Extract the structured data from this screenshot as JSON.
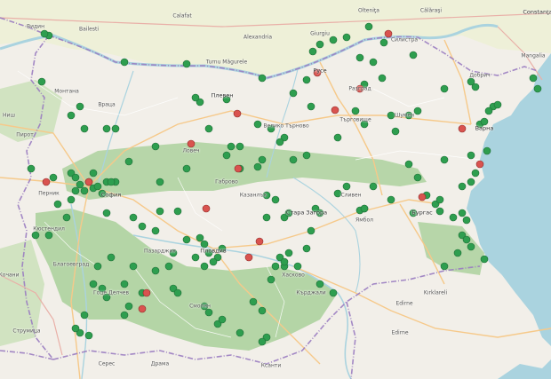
{
  "map": {
    "colors": {
      "marker_green": "#2e9e4f",
      "marker_red": "#d9534f",
      "sea": "#aad3df",
      "forest": "#add19e",
      "land": "#f2efe9",
      "border": "#9a7cc1"
    },
    "place_labels": [
      {
        "text": "Calafat",
        "kind": "town"
      },
      {
        "text": "Bailesti",
        "kind": "town"
      },
      {
        "text": "Alexandria",
        "kind": "town"
      },
      {
        "text": "Turnu Măgurele",
        "kind": "town"
      },
      {
        "text": "Giurgiu",
        "kind": "town"
      },
      {
        "text": "Olteniţa",
        "kind": "town"
      },
      {
        "text": "Călăraşi",
        "kind": "town"
      },
      {
        "text": "Constanţa",
        "kind": "city"
      },
      {
        "text": "Mangalia",
        "kind": "town"
      },
      {
        "text": "Силистра",
        "kind": "town"
      },
      {
        "text": "Добрич",
        "kind": "town"
      },
      {
        "text": "Русе",
        "kind": "city"
      },
      {
        "text": "Разград",
        "kind": "town"
      },
      {
        "text": "Търговище",
        "kind": "town"
      },
      {
        "text": "Шумен",
        "kind": "town"
      },
      {
        "text": "Варна",
        "kind": "city"
      },
      {
        "text": "Велико Търново",
        "kind": "town"
      },
      {
        "text": "Плевен",
        "kind": "city"
      },
      {
        "text": "Монтана",
        "kind": "town"
      },
      {
        "text": "Враца",
        "kind": "town"
      },
      {
        "text": "Ловеч",
        "kind": "town"
      },
      {
        "text": "Габрово",
        "kind": "town"
      },
      {
        "text": "Пирот",
        "kind": "town"
      },
      {
        "text": "Перник",
        "kind": "town"
      },
      {
        "text": "София",
        "kind": "city"
      },
      {
        "text": "Кюстендил",
        "kind": "town"
      },
      {
        "text": "Благоевград",
        "kind": "town"
      },
      {
        "text": "Пловдив",
        "kind": "city"
      },
      {
        "text": "Пазарджик",
        "kind": "town"
      },
      {
        "text": "Казанлък",
        "kind": "town"
      },
      {
        "text": "Стара Загора",
        "kind": "city"
      },
      {
        "text": "Сливен",
        "kind": "town"
      },
      {
        "text": "Ямбол",
        "kind": "town"
      },
      {
        "text": "Бургас",
        "kind": "city"
      },
      {
        "text": "Хасково",
        "kind": "town"
      },
      {
        "text": "Кърджали",
        "kind": "town"
      },
      {
        "text": "Смолян",
        "kind": "town"
      },
      {
        "text": "Гоце Делчев",
        "kind": "town"
      },
      {
        "text": "Edirne",
        "kind": "town"
      },
      {
        "text": "Kırklareli",
        "kind": "town"
      },
      {
        "text": "Драма",
        "kind": "town"
      },
      {
        "text": "Ксанти",
        "kind": "town"
      },
      {
        "text": "Серес",
        "kind": "town"
      },
      {
        "text": "Струмица",
        "kind": "town"
      },
      {
        "text": "Кочани",
        "kind": "town"
      },
      {
        "text": "Ниш",
        "kind": "town"
      },
      {
        "text": "Видин",
        "kind": "town"
      },
      {
        "text": "Edirne",
        "kind": "town"
      }
    ]
  }
}
